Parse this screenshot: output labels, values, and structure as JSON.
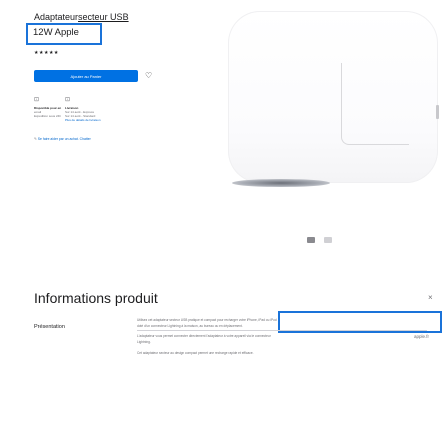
{
  "product": {
    "breadcrumb_main": "Adaptateur",
    "breadcrumb_sub": "secteur USB",
    "title": "12W Apple",
    "stars": "★★★★★",
    "add_to_cart": "Ajouter au Panier",
    "shipping": [
      {
        "heading": "Disponible pour en",
        "line1": "email",
        "line2": "Expédition sous 24h",
        "link": ""
      },
      {
        "heading": "Livraison",
        "line1": "Sur 14 août - Express",
        "line2": "Sur 14 août - Standard",
        "link": "Plus de détails de livraison"
      }
    ],
    "chat_text": "Se faire aider par un achat. Chatter"
  },
  "gallery": {
    "thumbnails": [
      "thumb-front",
      "thumb-side"
    ]
  },
  "info": {
    "section_title": "Informations produit",
    "collapse_icon": "×",
    "presentation_label": "Présentation",
    "description_lines": [
      "Utilisez cet adaptateur secteur USB pratique et compact pour recharger votre iPhone, iPad ou iPod",
      "doté d'un connecteur Lightning à la maison, au bureau ou en déplacement.",
      "L'adaptateur vous permet connecter directement l'adaptateur à votre appareil via le connecteur",
      "Lightning."
    ],
    "description_link": "apple.fr",
    "description_closing": "Cet adaptateur secteur au design compact permet une recharge rapide et efficace."
  }
}
